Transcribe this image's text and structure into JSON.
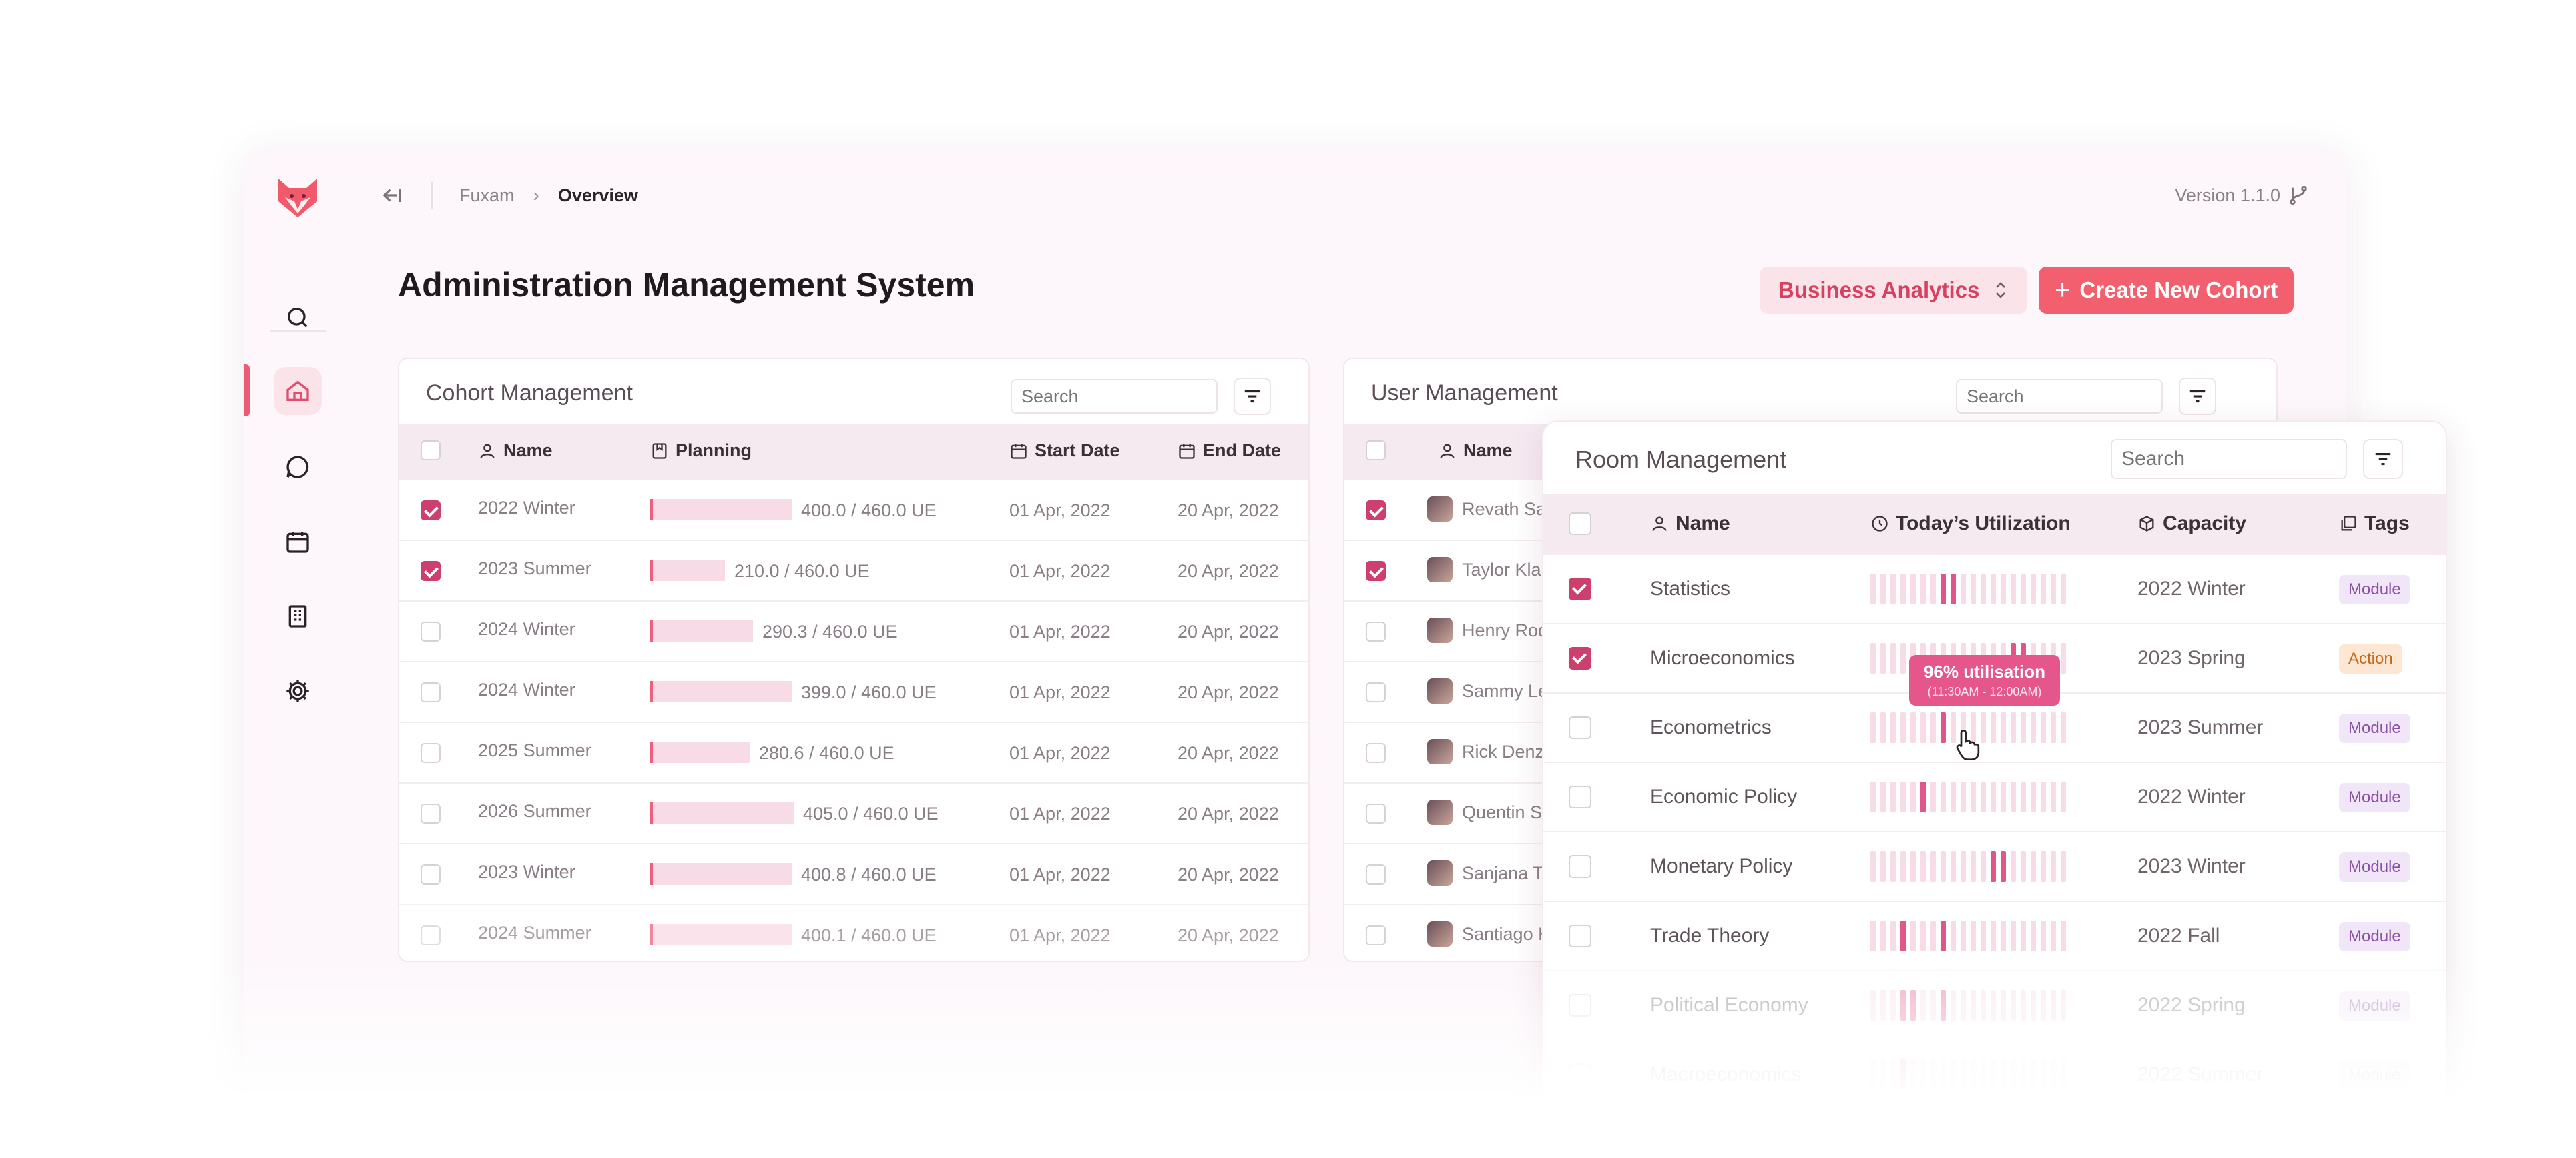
{
  "breadcrumb": {
    "root": "Fuxam",
    "current": "Overview"
  },
  "version": "Version 1.1.0",
  "page_title": "Administration Management System",
  "buttons": {
    "analytics": "Business Analytics",
    "create": "Create New Cohort",
    "create_plus": "+"
  },
  "cohort": {
    "title": "Cohort Management",
    "search_placeholder": "Search",
    "columns": {
      "name": "Name",
      "planning": "Planning",
      "start": "Start Date",
      "end": "End Date"
    },
    "rows": [
      {
        "name": "2022 Winter",
        "planning": "400.0 / 460.0 UE",
        "fill": 0.87,
        "start": "01 Apr, 2022",
        "end": "20 Apr, 2022",
        "checked": true
      },
      {
        "name": "2023 Summer",
        "planning": "210.0 / 460.0 UE",
        "fill": 0.46,
        "start": "01 Apr, 2022",
        "end": "20 Apr, 2022",
        "checked": true
      },
      {
        "name": "2024 Winter",
        "planning": "290.3 / 460.0 UE",
        "fill": 0.63,
        "start": "01 Apr, 2022",
        "end": "20 Apr, 2022",
        "checked": false
      },
      {
        "name": "2024 Winter",
        "planning": "399.0 / 460.0 UE",
        "fill": 0.87,
        "start": "01 Apr, 2022",
        "end": "20 Apr, 2022",
        "checked": false
      },
      {
        "name": "2025 Summer",
        "planning": "280.6 / 460.0 UE",
        "fill": 0.61,
        "start": "01 Apr, 2022",
        "end": "20 Apr, 2022",
        "checked": false
      },
      {
        "name": "2026 Summer",
        "planning": "405.0 / 460.0 UE",
        "fill": 0.88,
        "start": "01 Apr, 2022",
        "end": "20 Apr, 2022",
        "checked": false
      },
      {
        "name": "2023 Winter",
        "planning": "400.8 / 460.0 UE",
        "fill": 0.87,
        "start": "01 Apr, 2022",
        "end": "20 Apr, 2022",
        "checked": false
      },
      {
        "name": "2024 Summer",
        "planning": "400.1 / 460.0 UE",
        "fill": 0.87,
        "start": "01 Apr, 2022",
        "end": "20 Apr, 2022",
        "checked": false
      }
    ]
  },
  "users": {
    "title": "User Management",
    "search_placeholder": "Search",
    "columns": {
      "name": "Name"
    },
    "rows": [
      {
        "name": "Revath Sah",
        "checked": true
      },
      {
        "name": "Taylor Klau",
        "checked": true
      },
      {
        "name": "Henry Rodr",
        "checked": false
      },
      {
        "name": "Sammy Ler",
        "checked": false
      },
      {
        "name": "Rick Denzin",
        "checked": false
      },
      {
        "name": "Quentin Sc",
        "checked": false
      },
      {
        "name": "Sanjana Ta",
        "checked": false
      },
      {
        "name": "Santiago H",
        "checked": false
      }
    ]
  },
  "rooms": {
    "title": "Room Management",
    "search_placeholder": "Search",
    "columns": {
      "name": "Name",
      "utilization": "Today’s Utilization",
      "capacity": "Capacity",
      "tags": "Tags"
    },
    "rows": [
      {
        "name": "Statistics",
        "capacity": "2022 Winter",
        "tag": "Module",
        "tag_type": "module",
        "checked": true,
        "high": [
          7,
          8
        ]
      },
      {
        "name": "Microeconomics",
        "capacity": "2023 Spring",
        "tag": "Action",
        "tag_type": "action",
        "checked": true,
        "high": [
          14,
          15
        ]
      },
      {
        "name": "Econometrics",
        "capacity": "2023 Summer",
        "tag": "Module",
        "tag_type": "module",
        "checked": false,
        "high": [
          7
        ]
      },
      {
        "name": "Economic Policy",
        "capacity": "2022 Winter",
        "tag": "Module",
        "tag_type": "module",
        "checked": false,
        "high": [
          5
        ]
      },
      {
        "name": "Monetary Policy",
        "capacity": "2023 Winter",
        "tag": "Module",
        "tag_type": "module",
        "checked": false,
        "high": [
          12,
          13
        ]
      },
      {
        "name": "Trade Theory",
        "capacity": "2022 Fall",
        "tag": "Module",
        "tag_type": "module",
        "checked": false,
        "high": [
          3,
          7
        ]
      },
      {
        "name": "Political Economy",
        "capacity": "2022 Spring",
        "tag": "Module",
        "tag_type": "module",
        "checked": false,
        "high": [
          3,
          4,
          7
        ]
      },
      {
        "name": "Macroeconomics",
        "capacity": "2022 Summer",
        "tag": "Module",
        "tag_type": "module",
        "checked": false,
        "high": [
          3
        ]
      }
    ],
    "tooltip": {
      "title": "96% utilisation",
      "subtitle": "(11:30AM - 12:00AM)"
    }
  },
  "colors": {
    "accent": "#f2606f",
    "brand_pink": "#cd3f6d",
    "bar_fill": "#f7dbe6",
    "util_high": "#e0558a",
    "util_low": "#f7dbe6"
  },
  "icons": [
    "fox-logo",
    "search-icon",
    "home-icon",
    "chat-icon",
    "calendar-icon",
    "building-icon",
    "gear-icon",
    "collapse-icon",
    "branch-icon",
    "filter-icon",
    "user-icon",
    "planning-icon",
    "clock-icon",
    "box-icon",
    "tags-icon",
    "updown-icon",
    "cursor-icon"
  ]
}
